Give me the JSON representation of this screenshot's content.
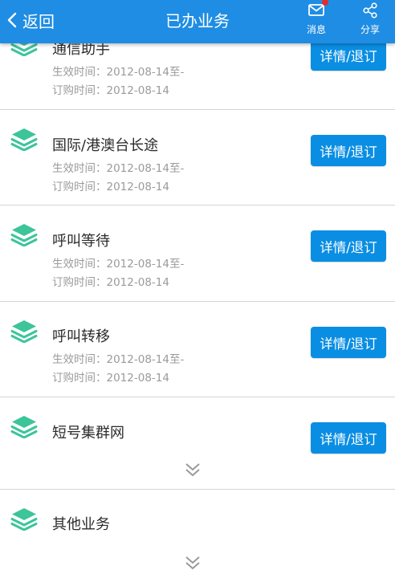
{
  "header": {
    "back_label": "返回",
    "title": "已办业务",
    "message_label": "消息",
    "share_label": "分享",
    "message_badge_color": "#e52a2a"
  },
  "theme": {
    "nav_bg": "#1f8de3",
    "button_bg": "#0a8ee3",
    "icon_green": "#3cc49a"
  },
  "services": [
    {
      "name": "通信助手",
      "effective": "生效时间：2012-08-14至-",
      "ordered": "订购时间：2012-08-14",
      "button": "详情/退订"
    },
    {
      "name": "国际/港澳台长途",
      "effective": "生效时间：2012-08-14至-",
      "ordered": "订购时间：2012-08-14",
      "button": "详情/退订"
    },
    {
      "name": "呼叫等待",
      "effective": "生效时间：2012-08-14至-",
      "ordered": "订购时间：2012-08-14",
      "button": "详情/退订"
    },
    {
      "name": "呼叫转移",
      "effective": "生效时间：2012-08-14至-",
      "ordered": "订购时间：2012-08-14",
      "button": "详情/退订"
    }
  ],
  "groups": [
    {
      "name": "短号集群网",
      "button": "详情/退订"
    },
    {
      "name": "其他业务"
    }
  ]
}
